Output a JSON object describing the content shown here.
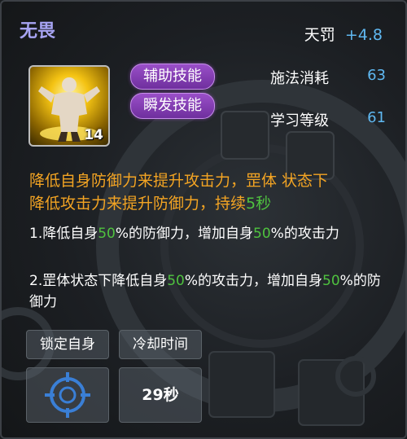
{
  "skill": {
    "name": "无畏",
    "attribute_label": "天罚",
    "attribute_value": "+4.8",
    "icon": "muscle-figure-icon",
    "level": "14",
    "tags": [
      "辅助技能",
      "瞬发技能"
    ],
    "stats": [
      {
        "label": "施法消耗",
        "value": "63"
      },
      {
        "label": "学习等级",
        "value": "61"
      }
    ]
  },
  "description": {
    "line1": "降低自身防御力来提升攻击力，罡体 状态下",
    "line2a": "降低攻击力来提升防御力，持续",
    "line2b": "5秒"
  },
  "effects": [
    {
      "p1": "1.降低自身",
      "n1": "50",
      "p2": "%的防御力，增加自身",
      "n2": "50",
      "p3": "%的攻击力"
    },
    {
      "p1": "2.罡体状态下降低自身",
      "n1": "50",
      "p2": "%的攻击力，增加自身",
      "n2": "50",
      "p3": "%的防御力"
    }
  ],
  "buttons": {
    "lock_label": "锁定自身",
    "cooldown_label": "冷却时间",
    "cooldown_value": "29秒"
  },
  "colors": {
    "title": "#a7a4f3",
    "value": "#5fb8f1",
    "description": "#f3a423",
    "highlight": "#4fc23f",
    "tag": "#8a3fbf"
  }
}
